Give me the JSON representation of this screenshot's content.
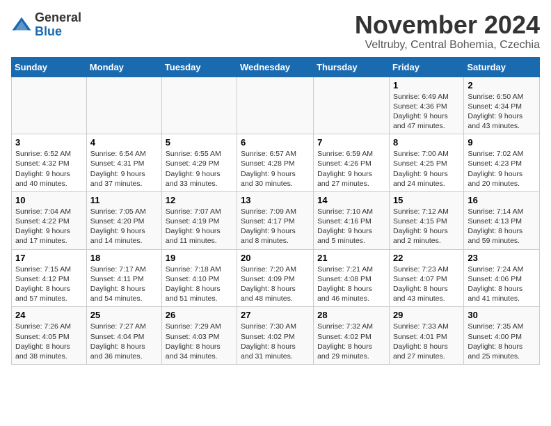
{
  "header": {
    "logo_line1": "General",
    "logo_line2": "Blue",
    "month_title": "November 2024",
    "location": "Veltruby, Central Bohemia, Czechia"
  },
  "days_of_week": [
    "Sunday",
    "Monday",
    "Tuesday",
    "Wednesday",
    "Thursday",
    "Friday",
    "Saturday"
  ],
  "weeks": [
    {
      "days": [
        {
          "num": "",
          "info": ""
        },
        {
          "num": "",
          "info": ""
        },
        {
          "num": "",
          "info": ""
        },
        {
          "num": "",
          "info": ""
        },
        {
          "num": "",
          "info": ""
        },
        {
          "num": "1",
          "info": "Sunrise: 6:49 AM\nSunset: 4:36 PM\nDaylight: 9 hours and 47 minutes."
        },
        {
          "num": "2",
          "info": "Sunrise: 6:50 AM\nSunset: 4:34 PM\nDaylight: 9 hours and 43 minutes."
        }
      ]
    },
    {
      "days": [
        {
          "num": "3",
          "info": "Sunrise: 6:52 AM\nSunset: 4:32 PM\nDaylight: 9 hours and 40 minutes."
        },
        {
          "num": "4",
          "info": "Sunrise: 6:54 AM\nSunset: 4:31 PM\nDaylight: 9 hours and 37 minutes."
        },
        {
          "num": "5",
          "info": "Sunrise: 6:55 AM\nSunset: 4:29 PM\nDaylight: 9 hours and 33 minutes."
        },
        {
          "num": "6",
          "info": "Sunrise: 6:57 AM\nSunset: 4:28 PM\nDaylight: 9 hours and 30 minutes."
        },
        {
          "num": "7",
          "info": "Sunrise: 6:59 AM\nSunset: 4:26 PM\nDaylight: 9 hours and 27 minutes."
        },
        {
          "num": "8",
          "info": "Sunrise: 7:00 AM\nSunset: 4:25 PM\nDaylight: 9 hours and 24 minutes."
        },
        {
          "num": "9",
          "info": "Sunrise: 7:02 AM\nSunset: 4:23 PM\nDaylight: 9 hours and 20 minutes."
        }
      ]
    },
    {
      "days": [
        {
          "num": "10",
          "info": "Sunrise: 7:04 AM\nSunset: 4:22 PM\nDaylight: 9 hours and 17 minutes."
        },
        {
          "num": "11",
          "info": "Sunrise: 7:05 AM\nSunset: 4:20 PM\nDaylight: 9 hours and 14 minutes."
        },
        {
          "num": "12",
          "info": "Sunrise: 7:07 AM\nSunset: 4:19 PM\nDaylight: 9 hours and 11 minutes."
        },
        {
          "num": "13",
          "info": "Sunrise: 7:09 AM\nSunset: 4:17 PM\nDaylight: 9 hours and 8 minutes."
        },
        {
          "num": "14",
          "info": "Sunrise: 7:10 AM\nSunset: 4:16 PM\nDaylight: 9 hours and 5 minutes."
        },
        {
          "num": "15",
          "info": "Sunrise: 7:12 AM\nSunset: 4:15 PM\nDaylight: 9 hours and 2 minutes."
        },
        {
          "num": "16",
          "info": "Sunrise: 7:14 AM\nSunset: 4:13 PM\nDaylight: 8 hours and 59 minutes."
        }
      ]
    },
    {
      "days": [
        {
          "num": "17",
          "info": "Sunrise: 7:15 AM\nSunset: 4:12 PM\nDaylight: 8 hours and 57 minutes."
        },
        {
          "num": "18",
          "info": "Sunrise: 7:17 AM\nSunset: 4:11 PM\nDaylight: 8 hours and 54 minutes."
        },
        {
          "num": "19",
          "info": "Sunrise: 7:18 AM\nSunset: 4:10 PM\nDaylight: 8 hours and 51 minutes."
        },
        {
          "num": "20",
          "info": "Sunrise: 7:20 AM\nSunset: 4:09 PM\nDaylight: 8 hours and 48 minutes."
        },
        {
          "num": "21",
          "info": "Sunrise: 7:21 AM\nSunset: 4:08 PM\nDaylight: 8 hours and 46 minutes."
        },
        {
          "num": "22",
          "info": "Sunrise: 7:23 AM\nSunset: 4:07 PM\nDaylight: 8 hours and 43 minutes."
        },
        {
          "num": "23",
          "info": "Sunrise: 7:24 AM\nSunset: 4:06 PM\nDaylight: 8 hours and 41 minutes."
        }
      ]
    },
    {
      "days": [
        {
          "num": "24",
          "info": "Sunrise: 7:26 AM\nSunset: 4:05 PM\nDaylight: 8 hours and 38 minutes."
        },
        {
          "num": "25",
          "info": "Sunrise: 7:27 AM\nSunset: 4:04 PM\nDaylight: 8 hours and 36 minutes."
        },
        {
          "num": "26",
          "info": "Sunrise: 7:29 AM\nSunset: 4:03 PM\nDaylight: 8 hours and 34 minutes."
        },
        {
          "num": "27",
          "info": "Sunrise: 7:30 AM\nSunset: 4:02 PM\nDaylight: 8 hours and 31 minutes."
        },
        {
          "num": "28",
          "info": "Sunrise: 7:32 AM\nSunset: 4:02 PM\nDaylight: 8 hours and 29 minutes."
        },
        {
          "num": "29",
          "info": "Sunrise: 7:33 AM\nSunset: 4:01 PM\nDaylight: 8 hours and 27 minutes."
        },
        {
          "num": "30",
          "info": "Sunrise: 7:35 AM\nSunset: 4:00 PM\nDaylight: 8 hours and 25 minutes."
        }
      ]
    }
  ]
}
